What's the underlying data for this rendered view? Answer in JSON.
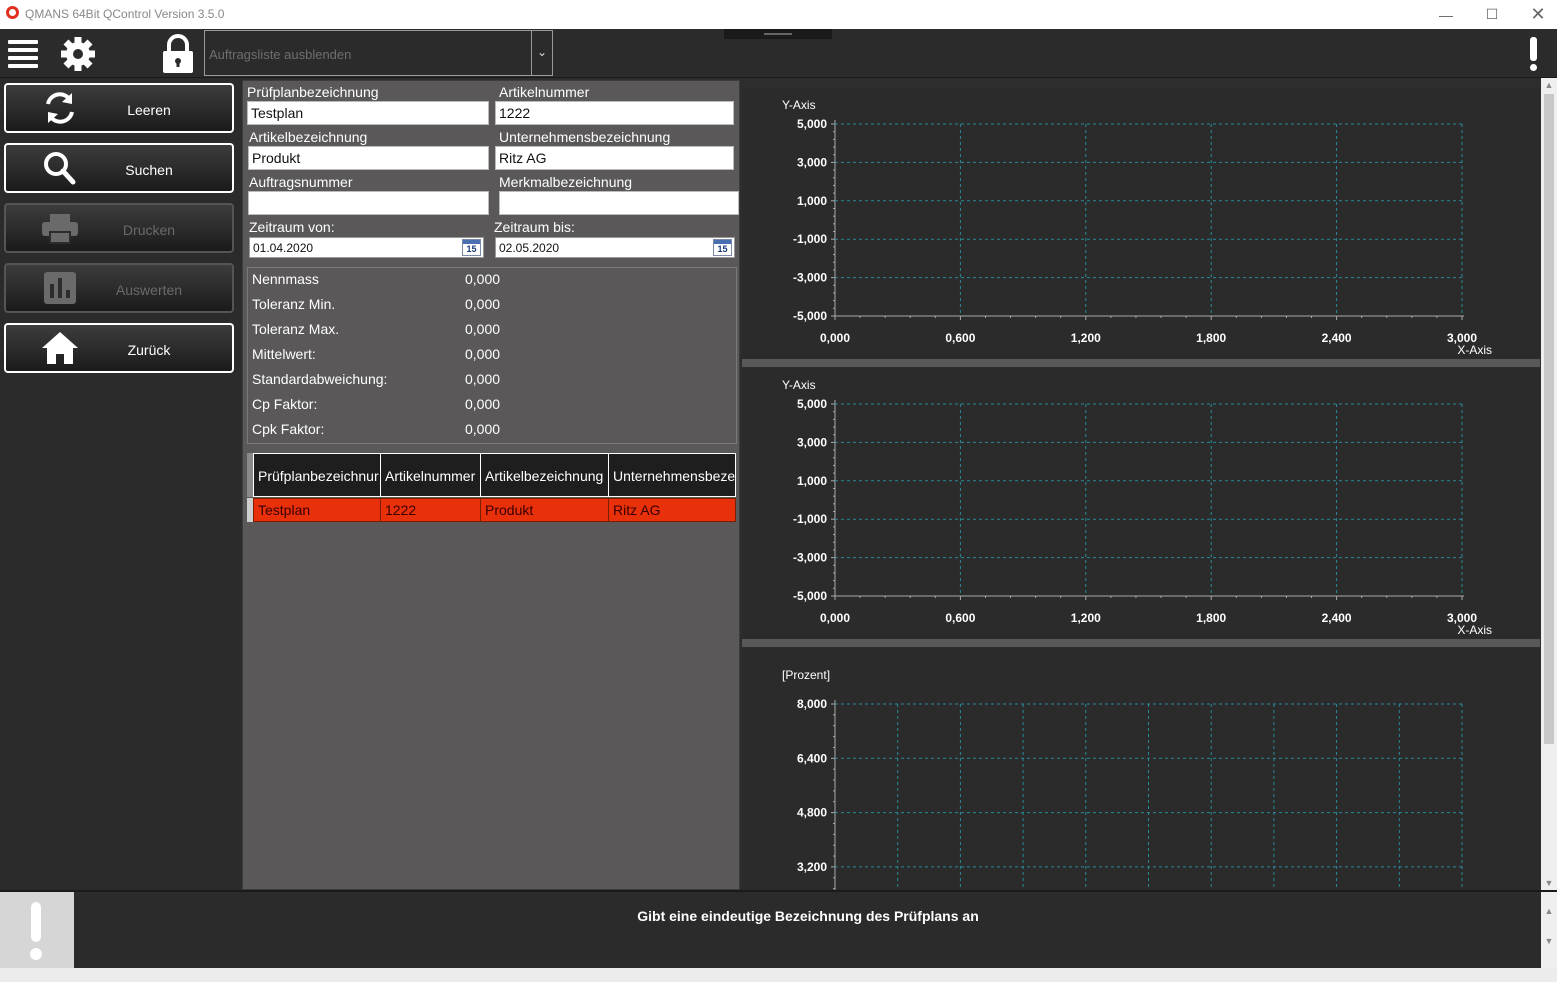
{
  "window": {
    "title": "QMANS 64Bit QControl Version 3.5.0"
  },
  "toolbar": {
    "order_placeholder": "Auftragsliste ausblenden"
  },
  "sidebar": {
    "buttons": [
      {
        "label": "Leeren"
      },
      {
        "label": "Suchen"
      },
      {
        "label": "Drucken"
      },
      {
        "label": "Auswerten"
      },
      {
        "label": "Zurück"
      }
    ]
  },
  "form": {
    "pruefplan_label": "Prüfplanbezeichnung",
    "pruefplan_value": "Testplan",
    "artikelnummer_label": "Artikelnummer",
    "artikelnummer_value": "1222",
    "artikelbez_label": "Artikelbezeichnung",
    "artikelbez_value": "Produkt",
    "unternehmen_label": "Unternehmensbezeichnung",
    "unternehmen_value": "Ritz AG",
    "auftrag_label": "Auftragsnummer",
    "auftrag_value": "",
    "merkmal_label": "Merkmalbezeichnung",
    "merkmal_value": "",
    "von_label": "Zeitraum von:",
    "von_value": "01.04.2020",
    "bis_label": "Zeitraum bis:",
    "bis_value": "02.05.2020",
    "calendar_day": "15"
  },
  "stats": [
    {
      "label": "Nennmass",
      "value": "0,000"
    },
    {
      "label": "Toleranz Min.",
      "value": "0,000"
    },
    {
      "label": "Toleranz Max.",
      "value": "0,000"
    },
    {
      "label": "Mittelwert:",
      "value": "0,000"
    },
    {
      "label": "Standardabweichung:",
      "value": "0,000"
    },
    {
      "label": "Cp Faktor:",
      "value": "0,000"
    },
    {
      "label": "Cpk Faktor:",
      "value": "0,000"
    }
  ],
  "table": {
    "headers": [
      "Prüfplanbezeichnur",
      "Artikelnummer",
      "Artikelbezeichnung",
      "Unternehmensbeze"
    ],
    "rows": [
      [
        "Testplan",
        "1222",
        "Produkt",
        "Ritz AG"
      ]
    ]
  },
  "chart_data": [
    {
      "type": "line",
      "ylabel": "Y-Axis",
      "xlabel": "X-Axis",
      "yticks": [
        "5,000",
        "3,000",
        "1,000",
        "-1,000",
        "-3,000",
        "-5,000"
      ],
      "xticks": [
        "0,000",
        "0,600",
        "1,200",
        "1,800",
        "2,400",
        "3,000"
      ],
      "ylim": [
        -5,
        5
      ],
      "xlim": [
        0,
        3
      ],
      "grid": true,
      "series": []
    },
    {
      "type": "line",
      "ylabel": "Y-Axis",
      "xlabel": "X-Axis",
      "yticks": [
        "5,000",
        "3,000",
        "1,000",
        "-1,000",
        "-3,000",
        "-5,000"
      ],
      "xticks": [
        "0,000",
        "0,600",
        "1,200",
        "1,800",
        "2,400",
        "3,000"
      ],
      "ylim": [
        -5,
        5
      ],
      "xlim": [
        0,
        3
      ],
      "grid": true,
      "series": []
    },
    {
      "type": "bar",
      "ylabel": "[Prozent]",
      "yticks": [
        "8,000",
        "6,400",
        "4,800",
        "3,200"
      ],
      "grid": true,
      "series": []
    }
  ],
  "help": {
    "text": "Gibt eine eindeutige Bezeichnung des Prüfplans an"
  },
  "colors": {
    "selected_row": "#e8300a",
    "grid": "#2a8a9a",
    "panel": "#5a5859"
  }
}
